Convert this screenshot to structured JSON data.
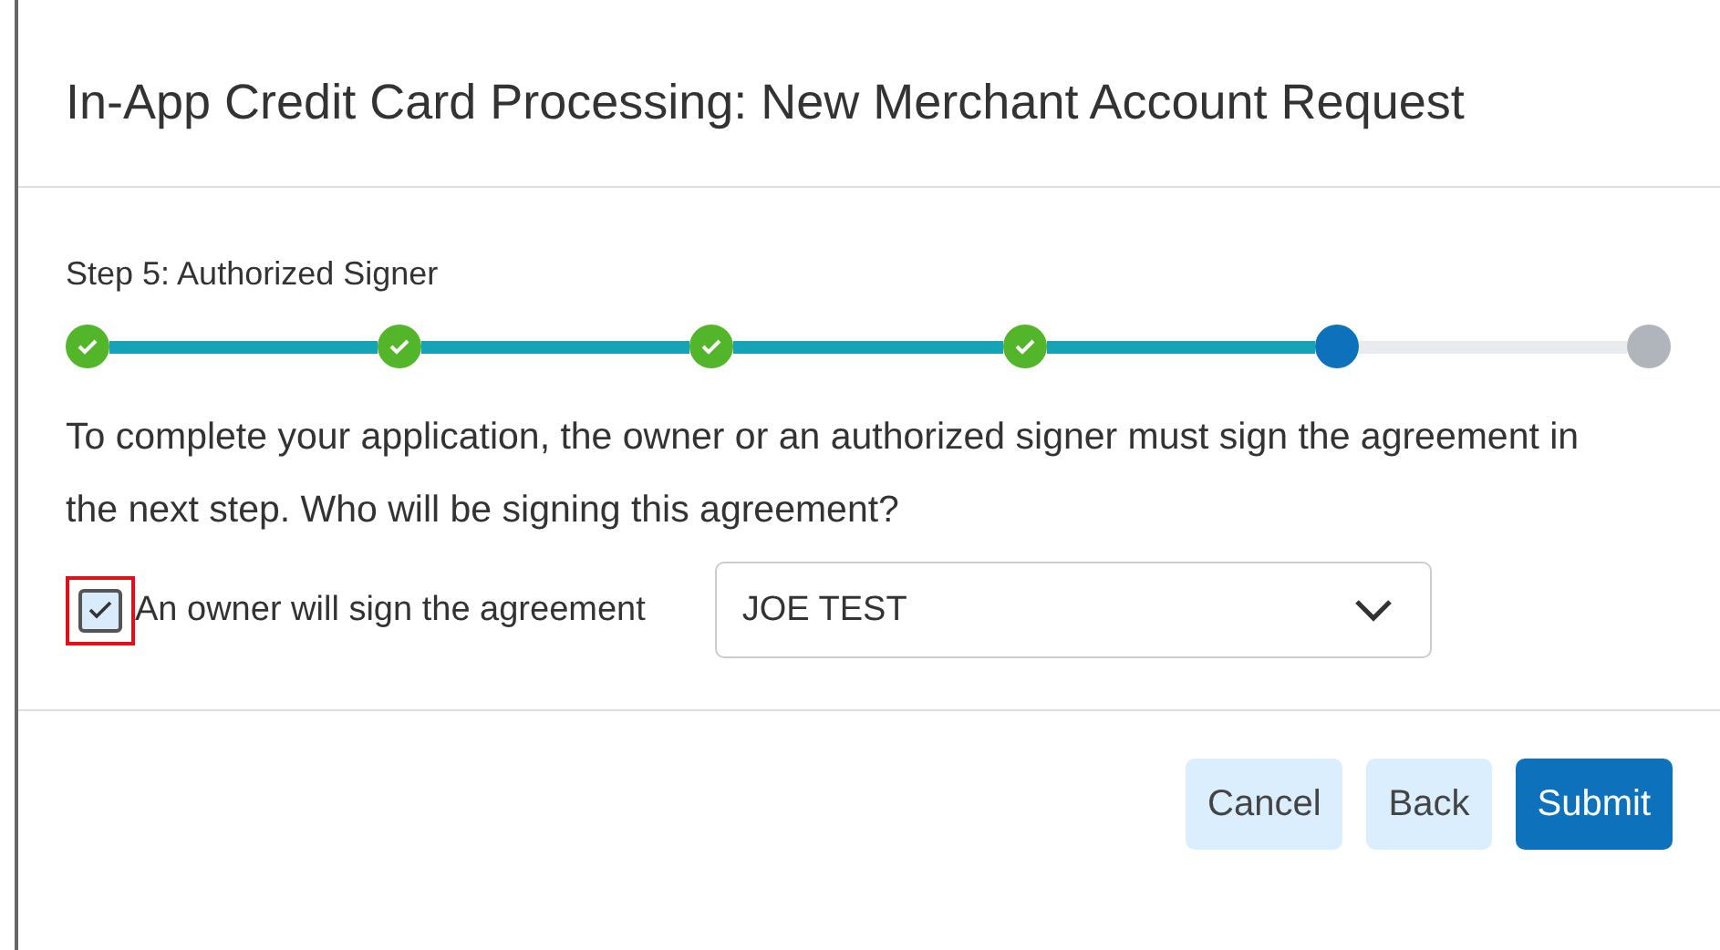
{
  "dialog": {
    "title": "In-App Credit Card Processing: New Merchant Account Request"
  },
  "step_label": "Step 5: Authorized Signer",
  "steps": [
    {
      "completed": true,
      "current": false
    },
    {
      "completed": true,
      "current": false
    },
    {
      "completed": true,
      "current": false
    },
    {
      "completed": true,
      "current": false
    },
    {
      "completed": false,
      "current": true
    },
    {
      "completed": false,
      "current": false
    }
  ],
  "message": "To complete your application, the owner or an authorized signer must sign the agreement in the next step. Who will be signing this agreement?",
  "owner_checkbox": {
    "label": "An owner will sign the agreement",
    "checked": true,
    "highlighted": true
  },
  "signer_select": {
    "value": "JOE TEST"
  },
  "buttons": [
    {
      "label": "Cancel",
      "kind": "secondary"
    },
    {
      "label": "Back",
      "kind": "secondary"
    },
    {
      "label": "Submit",
      "kind": "primary"
    }
  ]
}
